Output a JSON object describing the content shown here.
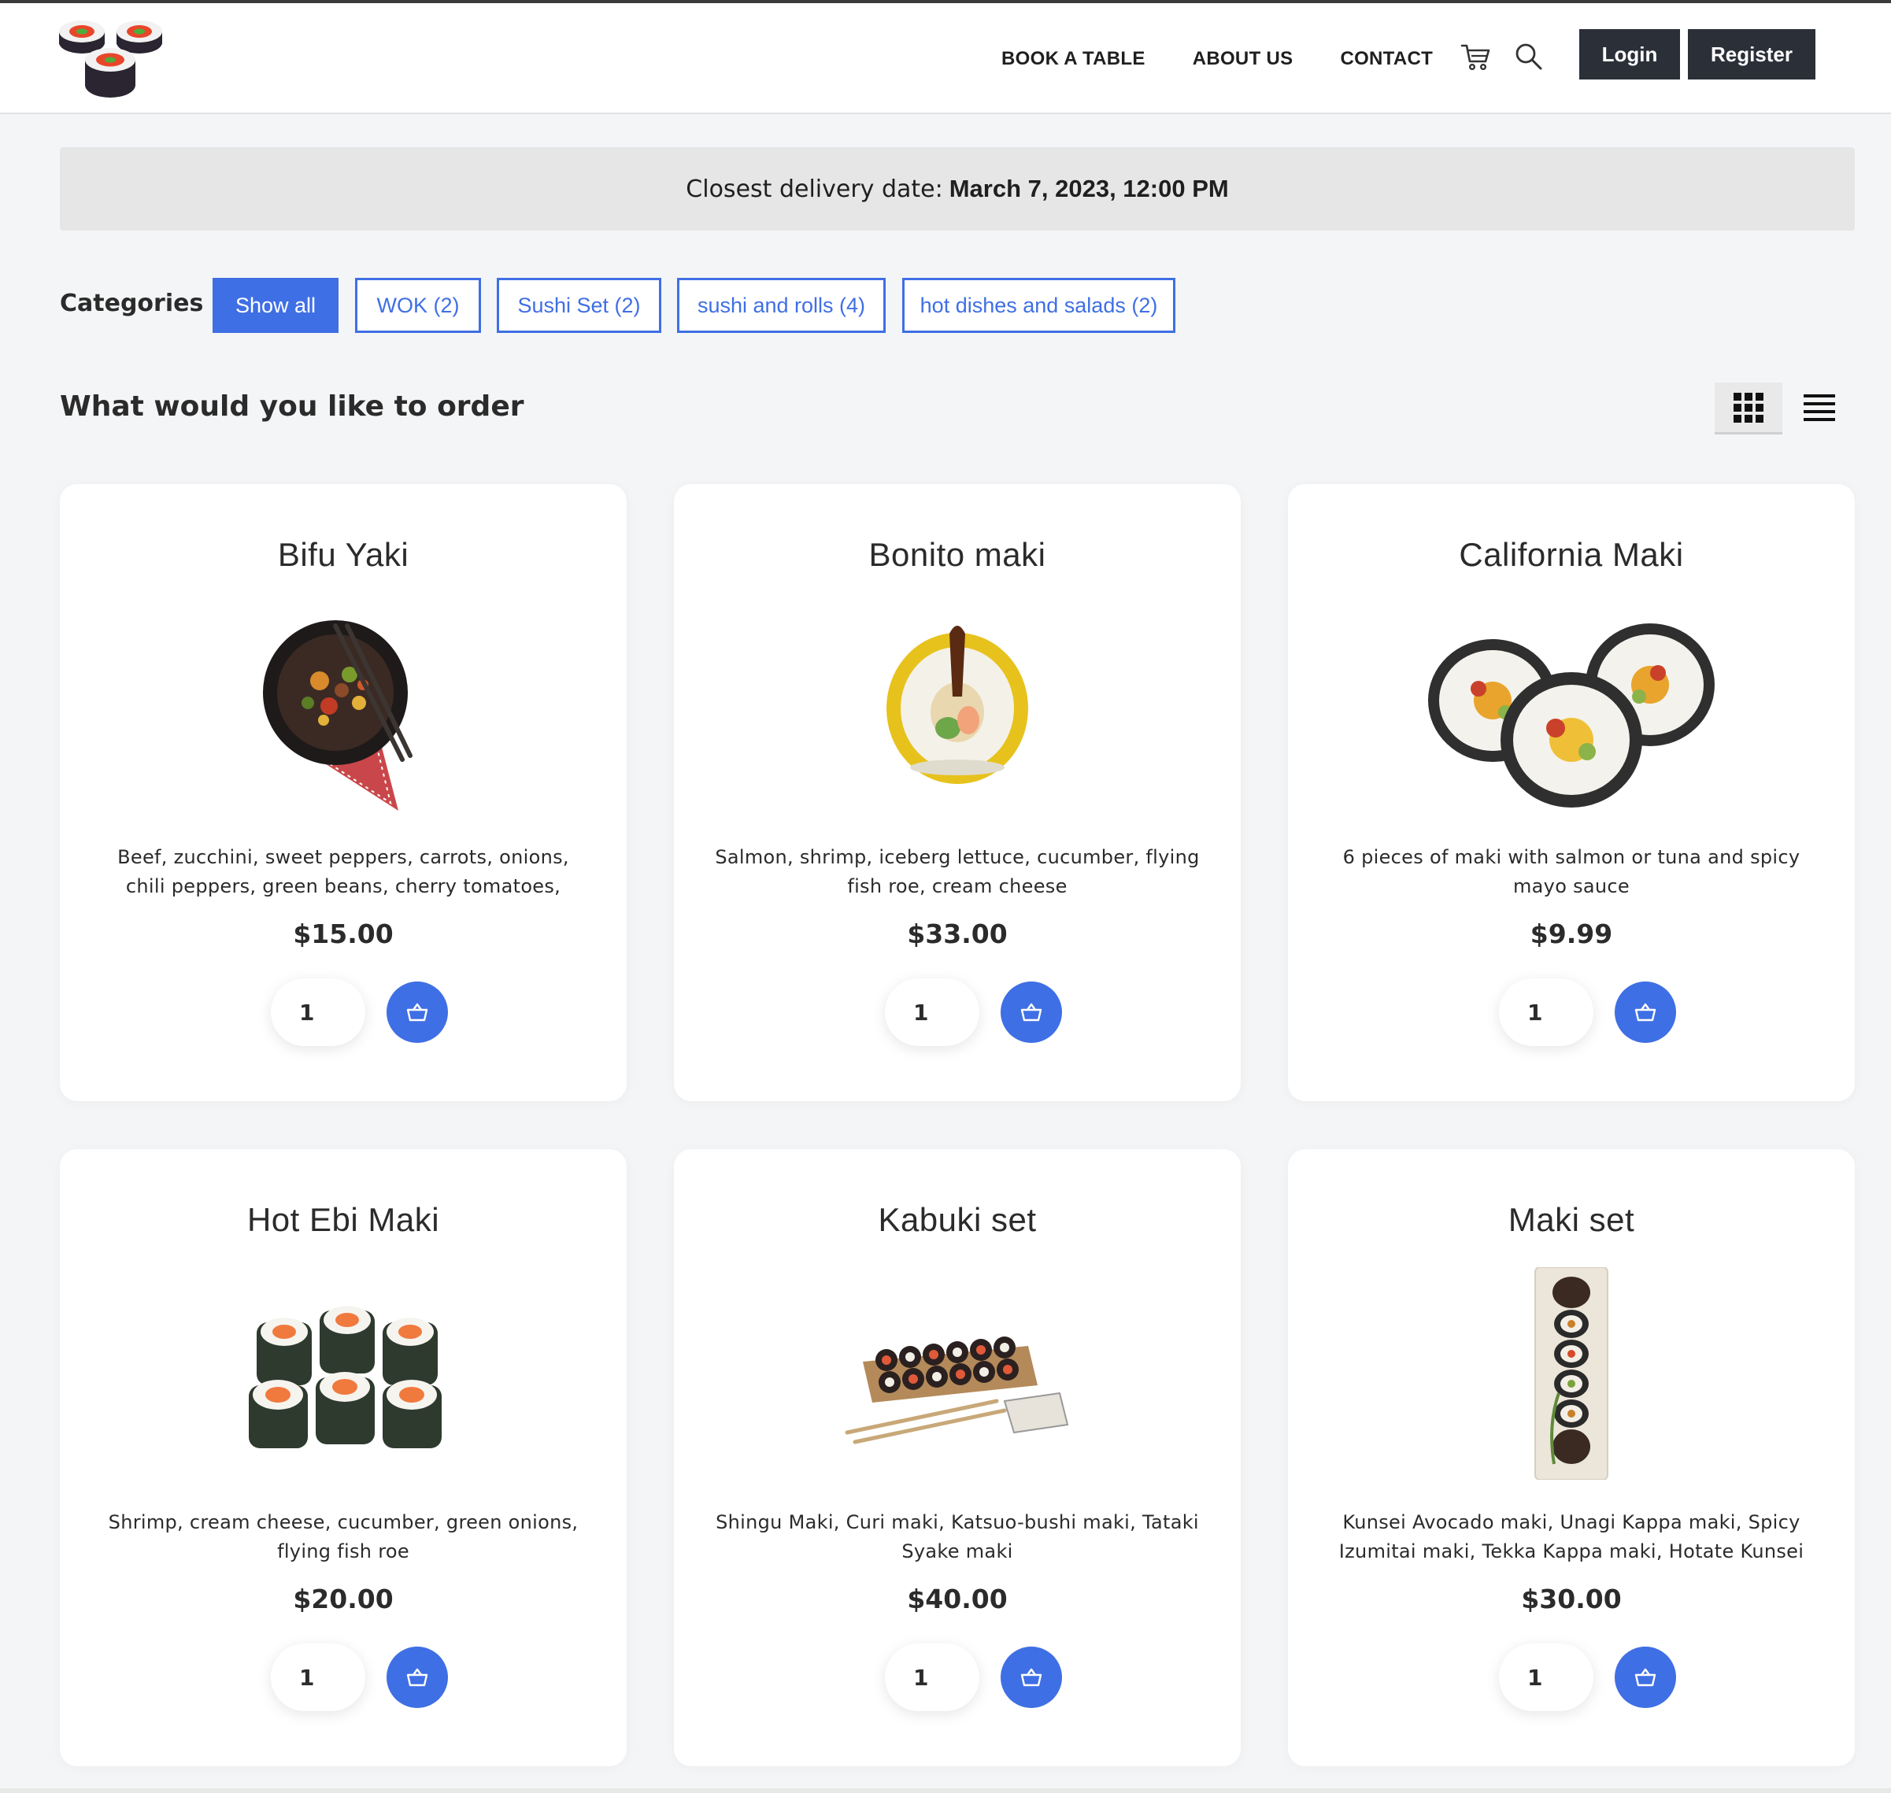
{
  "header": {
    "nav": [
      "BOOK A TABLE",
      "ABOUT US",
      "CONTACT"
    ],
    "login_label": "Login",
    "register_label": "Register",
    "icons": [
      "logo-sushi",
      "cart-icon",
      "search-icon"
    ]
  },
  "delivery": {
    "prefix": "Closest delivery date:",
    "date": "March 7, 2023, 12:00 PM"
  },
  "categories": {
    "label": "Categories",
    "items": [
      {
        "label": "Show all",
        "active": true
      },
      {
        "label": "WOK (2)",
        "active": false
      },
      {
        "label": "Sushi Set (2)",
        "active": false
      },
      {
        "label": "sushi and rolls (4)",
        "active": false
      },
      {
        "label": "hot dishes and salads (2)",
        "active": false
      }
    ]
  },
  "main": {
    "title": "What would you like to order",
    "view_modes": [
      {
        "name": "grid-view-icon",
        "active": true
      },
      {
        "name": "list-view-icon",
        "active": false
      }
    ]
  },
  "products": [
    {
      "name": "Bifu Yaki",
      "description": "Beef, zucchini, sweet peppers, carrots, onions, chili peppers, green beans, cherry tomatoes,",
      "price": "$15.00",
      "qty": "1",
      "image": "wok-bowl-image"
    },
    {
      "name": "Bonito maki",
      "description": "Salmon, shrimp, iceberg lettuce, cucumber, flying fish roe, cream cheese",
      "price": "$33.00",
      "qty": "1",
      "image": "bonito-roll-image"
    },
    {
      "name": "California Maki",
      "description": "6 pieces of maki with salmon or tuna and spicy mayo sauce",
      "price": "$9.99",
      "qty": "1",
      "image": "california-maki-image"
    },
    {
      "name": "Hot Ebi Maki",
      "description": "Shrimp, cream cheese, cucumber, green onions, flying fish roe",
      "price": "$20.00",
      "qty": "1",
      "image": "ebi-maki-image"
    },
    {
      "name": "Kabuki set",
      "description": "Shingu Maki, Curi maki, Katsuo-bushi maki, Tataki Syake maki",
      "price": "$40.00",
      "qty": "1",
      "image": "kabuki-set-image"
    },
    {
      "name": "Maki set",
      "description": "Kunsei Avocado maki, Unagi Kappa maki, Spicy Izumitai maki, Tekka Kappa maki, Hotate Kunsei",
      "price": "$30.00",
      "qty": "1",
      "image": "maki-set-image"
    }
  ],
  "colors": {
    "accent": "#3f6fe4",
    "dark_button": "#2b2f38",
    "banner": "#e6e6e7"
  }
}
